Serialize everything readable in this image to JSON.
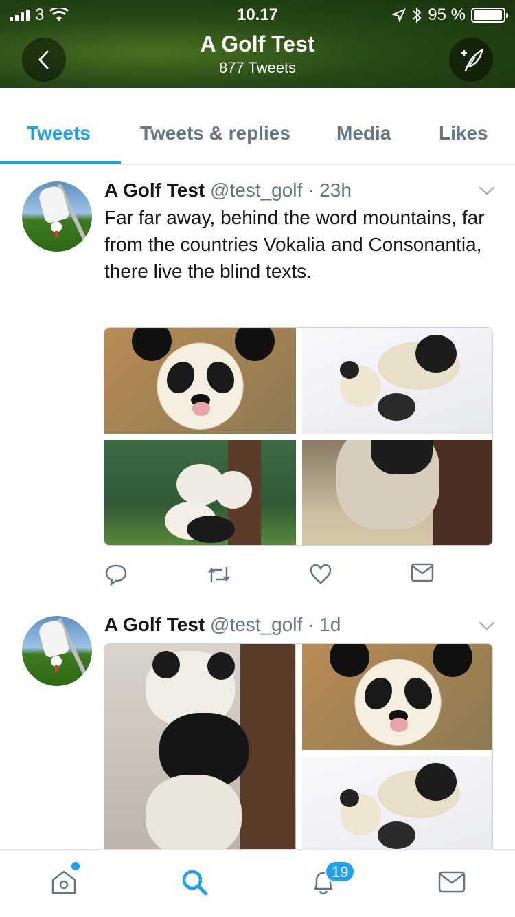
{
  "status_bar": {
    "carrier": "3",
    "time": "10.17",
    "battery": "95 %"
  },
  "header": {
    "title": "A Golf Test",
    "subtitle": "877 Tweets"
  },
  "tabs": [
    {
      "label": "Tweets",
      "active": true
    },
    {
      "label": "Tweets & replies",
      "active": false
    },
    {
      "label": "Media",
      "active": false
    },
    {
      "label": "Likes",
      "active": false
    }
  ],
  "tweets": [
    {
      "name": "A Golf Test",
      "handle": "@test_golf",
      "time": "· 23h",
      "text": "Far far away, behind the word mountains, far from the countries Vokalia and Consonantia, there live the blind texts."
    },
    {
      "name": "A Golf Test",
      "handle": "@test_golf",
      "time": "· 1d"
    }
  ],
  "bottom_nav": {
    "notifications_badge": "19"
  },
  "colors": {
    "accent": "#1da1f2",
    "secondary_text": "#657786",
    "border": "#e1e8ed"
  }
}
